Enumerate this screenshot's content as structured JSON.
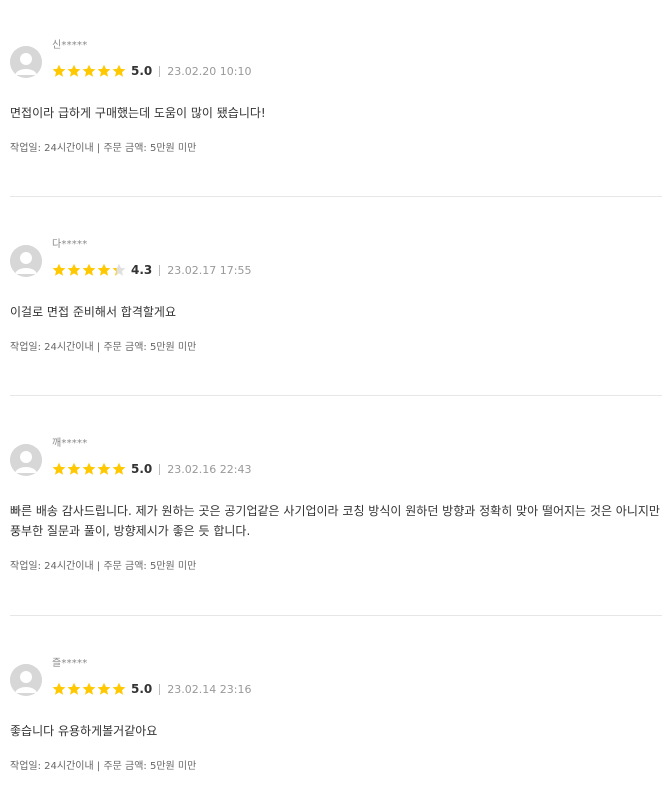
{
  "colors": {
    "star_filled": "#ffc800",
    "star_empty": "#e0e0e0",
    "divider": "#e6e6e6",
    "avatar_bg": "#d7d7d7"
  },
  "reviews": [
    {
      "author": "신*****",
      "rating": 5.0,
      "score_text": "5.0",
      "date": "23.02.20 10:10",
      "content": "면접이라 급하게 구매했는데 도움이 많이 됐습니다!",
      "info_label": "작업일:",
      "info_days": "24시간이내",
      "info_sep": "|",
      "info_price": "주문 금액: 5만원 미만",
      "avatar_icon": "user-avatar-icon",
      "star_icon": "star-icon"
    },
    {
      "author": "다*****",
      "rating": 4.3,
      "score_text": "4.3",
      "date": "23.02.17 17:55",
      "content": "이걸로 면접 준비해서  합격할게요",
      "info_label": "작업일:",
      "info_days": "24시간이내",
      "info_sep": "|",
      "info_price": "주문 금액: 5만원 미만",
      "avatar_icon": "user-avatar-icon",
      "star_icon": "star-icon"
    },
    {
      "author": "깨*****",
      "rating": 5.0,
      "score_text": "5.0",
      "date": "23.02.16 22:43",
      "content": "빠른 배송 감사드립니다. 제가 원하는 곳은 공기업같은 사기업이라 코칭 방식이 원하던 방향과 정확히 맞아 떨어지는 것은 아니지만 풍부한 질문과 풀이, 방향제시가 좋은 듯 합니다.",
      "info_label": "작업일:",
      "info_days": "24시간이내",
      "info_sep": "|",
      "info_price": "주문 금액: 5만원 미만",
      "avatar_icon": "user-avatar-icon",
      "star_icon": "star-icon"
    },
    {
      "author": "즐*****",
      "rating": 5.0,
      "score_text": "5.0",
      "date": "23.02.14 23:16",
      "content": "좋습니다 유용하게볼거같아요",
      "info_label": "작업일:",
      "info_days": "24시간이내",
      "info_sep": "|",
      "info_price": "주문 금액: 5만원 미만",
      "avatar_icon": "user-avatar-icon",
      "star_icon": "star-icon"
    }
  ]
}
